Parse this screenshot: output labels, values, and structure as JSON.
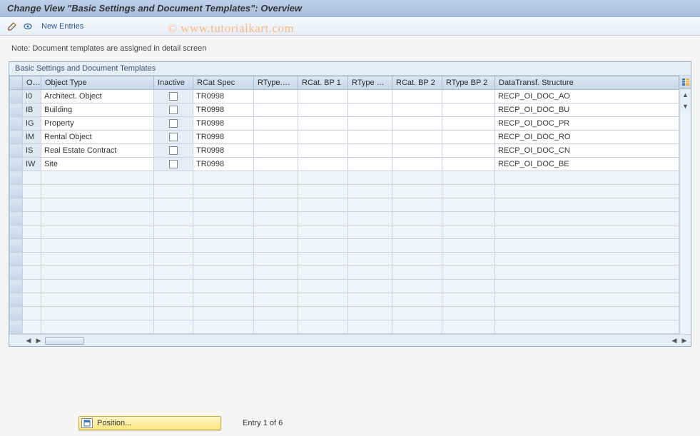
{
  "title": "Change View \"Basic Settings and Document Templates\": Overview",
  "toolbar": {
    "new_entries": "New Entries"
  },
  "note": "Note: Document templates are assigned in detail screen",
  "grid": {
    "caption": "Basic Settings and Document Templates",
    "columns": {
      "ot": "OT",
      "object_type": "Object Type",
      "inactive": "Inactive",
      "rcat_spec": "RCat Spec",
      "rtype_s": "RType.S...",
      "rcat_bp1": "RCat. BP 1",
      "rtype_b": "RType B...",
      "rcat_bp2": "RCat. BP 2",
      "rtype_bp2": "RType BP 2",
      "data_transf": "DataTransf. Structure"
    },
    "rows": [
      {
        "ot": "I0",
        "object_type": "Architect. Object",
        "rcat_spec": "TR0998",
        "data_transf": "RECP_OI_DOC_AO"
      },
      {
        "ot": "IB",
        "object_type": "Building",
        "rcat_spec": "TR0998",
        "data_transf": "RECP_OI_DOC_BU"
      },
      {
        "ot": "IG",
        "object_type": "Property",
        "rcat_spec": "TR0998",
        "data_transf": "RECP_OI_DOC_PR"
      },
      {
        "ot": "IM",
        "object_type": "Rental Object",
        "rcat_spec": "TR0998",
        "data_transf": "RECP_OI_DOC_RO"
      },
      {
        "ot": "IS",
        "object_type": "Real Estate Contract",
        "rcat_spec": "TR0998",
        "data_transf": "RECP_OI_DOC_CN"
      },
      {
        "ot": "IW",
        "object_type": "Site",
        "rcat_spec": "TR0998",
        "data_transf": "RECP_OI_DOC_BE"
      }
    ]
  },
  "footer": {
    "position_label": "Position...",
    "entry_text": "Entry 1 of 6"
  },
  "watermark": "© www.tutorialkart.com"
}
